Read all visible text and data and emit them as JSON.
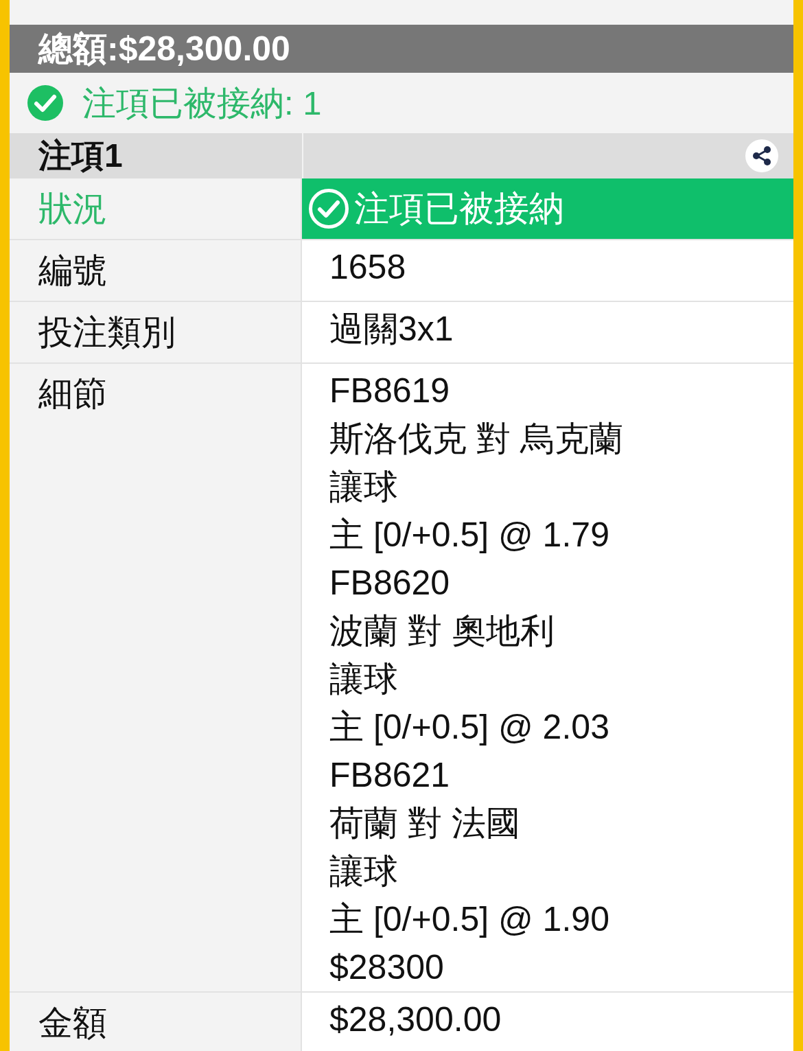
{
  "total": "總額:$28,300.00",
  "notice": {
    "accepted": true,
    "text": "注項已被接納: 1"
  },
  "bet": {
    "title": "注項1",
    "rows": [
      {
        "kind": "status",
        "label": "狀況",
        "value": "注項已被接納"
      },
      {
        "kind": "text",
        "label": "編號",
        "value": "1658"
      },
      {
        "kind": "text",
        "label": "投注類別",
        "value": "過關3x1"
      },
      {
        "kind": "lines",
        "label": "細節",
        "lines": [
          "FB8619",
          "斯洛伐克 對 烏克蘭",
          "讓球",
          "主 [0/+0.5] @ 1.79",
          "FB8620",
          "波蘭 對 奧地利",
          "讓球",
          "主 [0/+0.5] @ 2.03",
          "FB8621",
          "荷蘭 對 法國",
          "讓球",
          "主 [0/+0.5] @ 1.90",
          "$28300"
        ]
      },
      {
        "kind": "text",
        "label": "金額",
        "value": "$28,300.00"
      }
    ]
  }
}
